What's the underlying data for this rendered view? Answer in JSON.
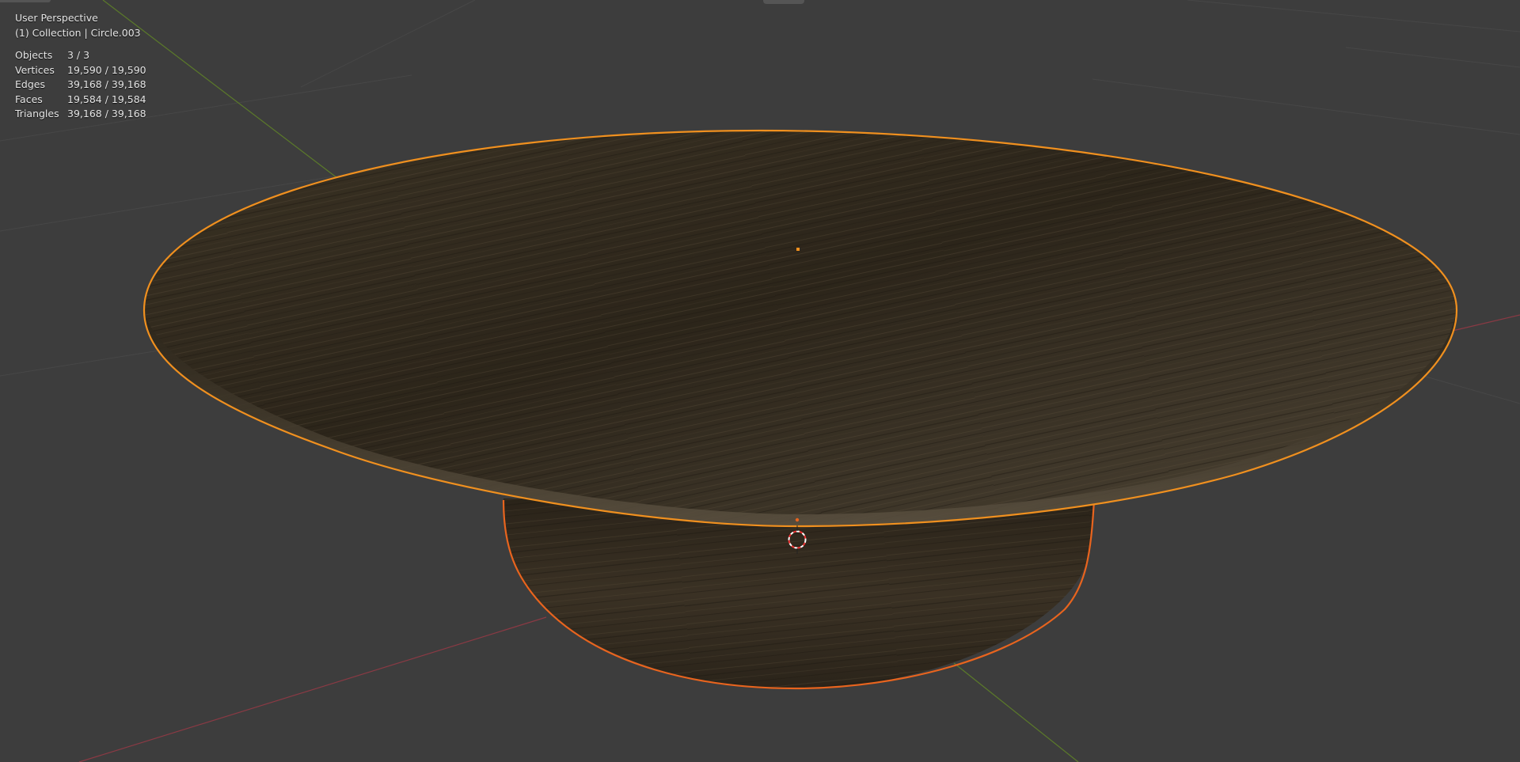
{
  "viewport": {
    "view_name": "User Perspective",
    "context": "(1) Collection | Circle.003",
    "stats": [
      {
        "label": "Objects",
        "value": "3 / 3"
      },
      {
        "label": "Vertices",
        "value": "19,590 / 19,590"
      },
      {
        "label": "Edges",
        "value": "39,168 / 39,168"
      },
      {
        "label": "Faces",
        "value": "19,584 / 19,584"
      },
      {
        "label": "Triangles",
        "value": "39,168 / 39,168"
      }
    ]
  },
  "colors": {
    "background": "#3d3d3d",
    "grid": "#474747",
    "x_axis": "#8a3a44",
    "y_axis": "#5b7a2a",
    "selection_outline": "#f0901f",
    "active_outline": "#e8641e",
    "wood_dark": "#2e2619",
    "wood_mid": "#4a4031"
  }
}
